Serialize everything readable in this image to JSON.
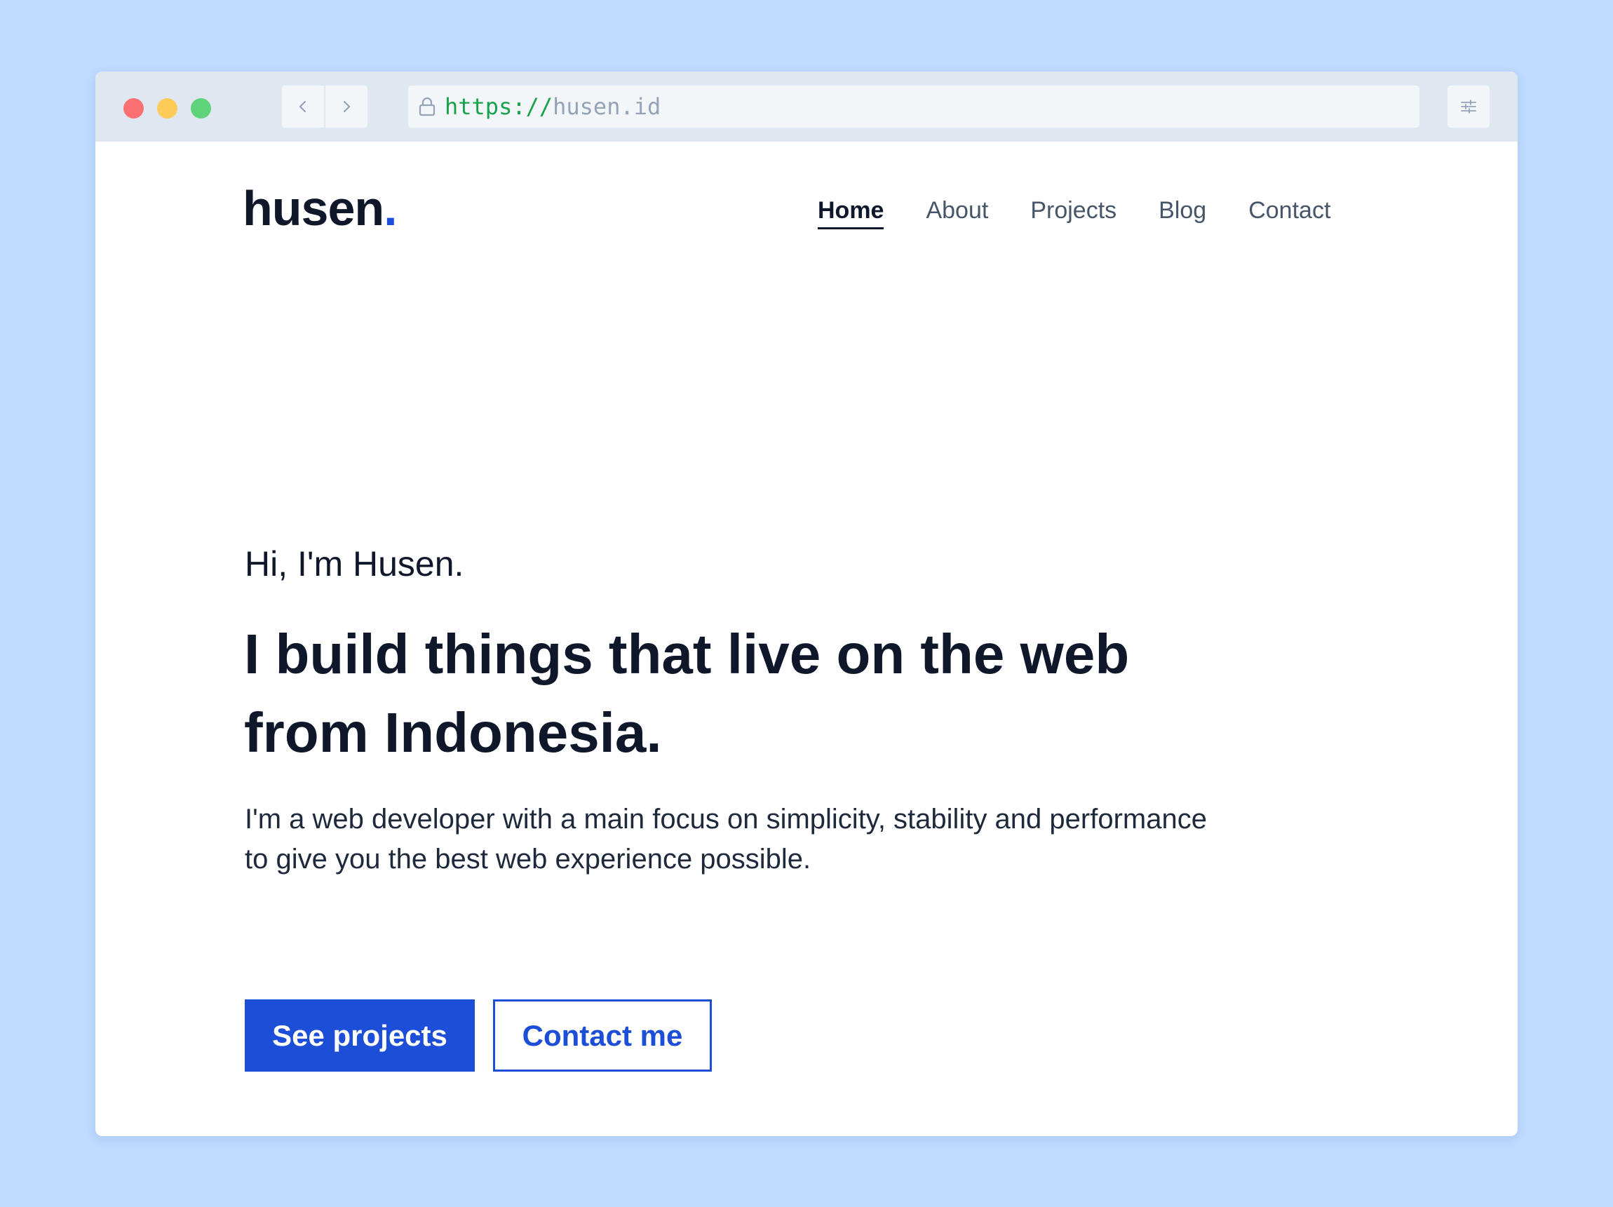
{
  "browser": {
    "url_scheme": "https://",
    "url_host": "husen.id"
  },
  "site": {
    "logo_text": "husen",
    "logo_dot": "."
  },
  "nav": {
    "items": [
      {
        "label": "Home",
        "active": true
      },
      {
        "label": "About",
        "active": false
      },
      {
        "label": "Projects",
        "active": false
      },
      {
        "label": "Blog",
        "active": false
      },
      {
        "label": "Contact",
        "active": false
      }
    ]
  },
  "hero": {
    "greeting": "Hi, I'm Husen.",
    "headline": "I build things that live on the web from Indonesia.",
    "intro": "I'm a web developer with a main focus on simplicity, stability and performance to give you the best web experience possible.",
    "primary_button": "See projects",
    "secondary_button": "Contact me"
  },
  "icons": {
    "back": "chevron-left-icon",
    "forward": "chevron-right-icon",
    "lock": "lock-icon",
    "settings": "sliders-icon"
  },
  "colors": {
    "background": "#bfdbfe",
    "accent": "#1d4ed8",
    "text_dark": "#0f172a",
    "nav_text": "#475569",
    "url_scheme": "#16a34a",
    "url_host": "#94a3b8"
  }
}
